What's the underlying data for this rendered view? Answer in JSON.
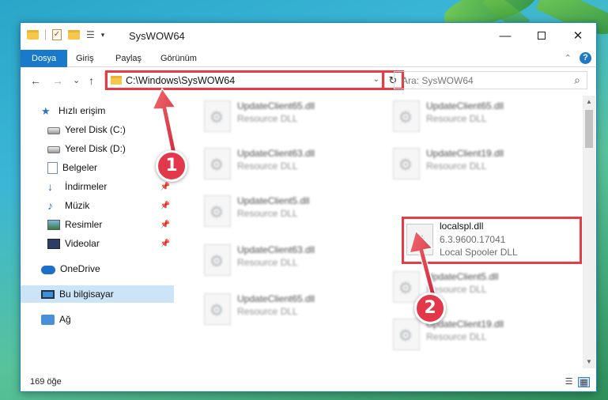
{
  "window": {
    "title": "SysWOW64",
    "minimize_glyph": "—",
    "close_glyph": "✕"
  },
  "ribbon": {
    "tabs": [
      "Dosya",
      "Giriş",
      "Paylaş",
      "Görünüm"
    ],
    "help_glyph": "?",
    "collapse_glyph": "⌃"
  },
  "navigation": {
    "back_glyph": "←",
    "forward_glyph": "→",
    "recent_glyph": "⌄",
    "up_glyph": "↑",
    "address": "C:\\Windows\\SysWOW64",
    "address_dropdown_glyph": "⌄",
    "refresh_glyph": "↻",
    "search_placeholder": "Ara: SysWOW64",
    "search_glyph": "⌕"
  },
  "sidebar": {
    "items": [
      {
        "label": "Hızlı erişim",
        "icon": "star-icon"
      },
      {
        "label": "Yerel Disk (C:)",
        "icon": "disk-icon"
      },
      {
        "label": "Yerel Disk (D:)",
        "icon": "disk-icon"
      },
      {
        "label": "Belgeler",
        "icon": "document-icon"
      },
      {
        "label": "İndirmeler",
        "icon": "download-icon",
        "pinned": true
      },
      {
        "label": "Müzik",
        "icon": "music-icon",
        "pinned": true
      },
      {
        "label": "Resimler",
        "icon": "pictures-icon",
        "pinned": true
      },
      {
        "label": "Videolar",
        "icon": "videos-icon",
        "pinned": true
      },
      {
        "label": "OneDrive",
        "icon": "onedrive-icon"
      },
      {
        "label": "Bu bilgisayar",
        "icon": "this-pc-icon",
        "selected": true
      },
      {
        "label": "Ağ",
        "icon": "network-icon"
      }
    ],
    "pin_glyph": "📌"
  },
  "files": {
    "blurred": [
      {
        "name": "UpdateClient65.dll",
        "type": "Resource DLL"
      },
      {
        "name": "UpdateClient65.dll",
        "type": "Resource DLL"
      },
      {
        "name": "UpdateClient63.dll",
        "type": "Resource DLL"
      },
      {
        "name": "UpdateClient19.dll",
        "type": "Resource DLL"
      },
      {
        "name": "UpdateClient5.dll",
        "type": "Resource DLL"
      },
      {
        "name": "UpdateClient63.dll",
        "type": "Resource DLL"
      },
      {
        "name": "UpdateClient5.dll",
        "type": "Resource DLL"
      },
      {
        "name": "UpdateClient65.dll",
        "type": "Resource DLL"
      },
      {
        "name": "UpdateClient19.dll",
        "type": "Resource DLL"
      }
    ],
    "highlighted": {
      "name": "localspl.dll",
      "version": "6.3.9600.17041",
      "description": "Local Spooler DLL"
    }
  },
  "status": {
    "item_count": "169 öğe"
  },
  "callouts": [
    "1",
    "2"
  ],
  "colors": {
    "accent": "#1979ca",
    "highlight": "#e83c44",
    "selection": "#cce4f7"
  }
}
